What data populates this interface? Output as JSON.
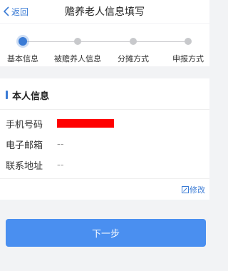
{
  "nav": {
    "back_label": "返回",
    "title": "赡养老人信息填写"
  },
  "steps": [
    {
      "label": "基本信息",
      "active": true
    },
    {
      "label": "被赡养人信息",
      "active": false
    },
    {
      "label": "分摊方式",
      "active": false
    },
    {
      "label": "申报方式",
      "active": false
    }
  ],
  "section": {
    "title": "本人信息"
  },
  "fields": {
    "phone_label": "手机号码",
    "phone_value_redacted": true,
    "email_label": "电子邮箱",
    "email_value": "--",
    "address_label": "联系地址",
    "address_value": "--"
  },
  "edit_label": "修改",
  "next_button_label": "下一步",
  "colors": {
    "accent": "#3a7bd5",
    "button": "#4a8ff0",
    "inactive_dot": "#c8c9cc",
    "redaction": "#ff0000"
  }
}
